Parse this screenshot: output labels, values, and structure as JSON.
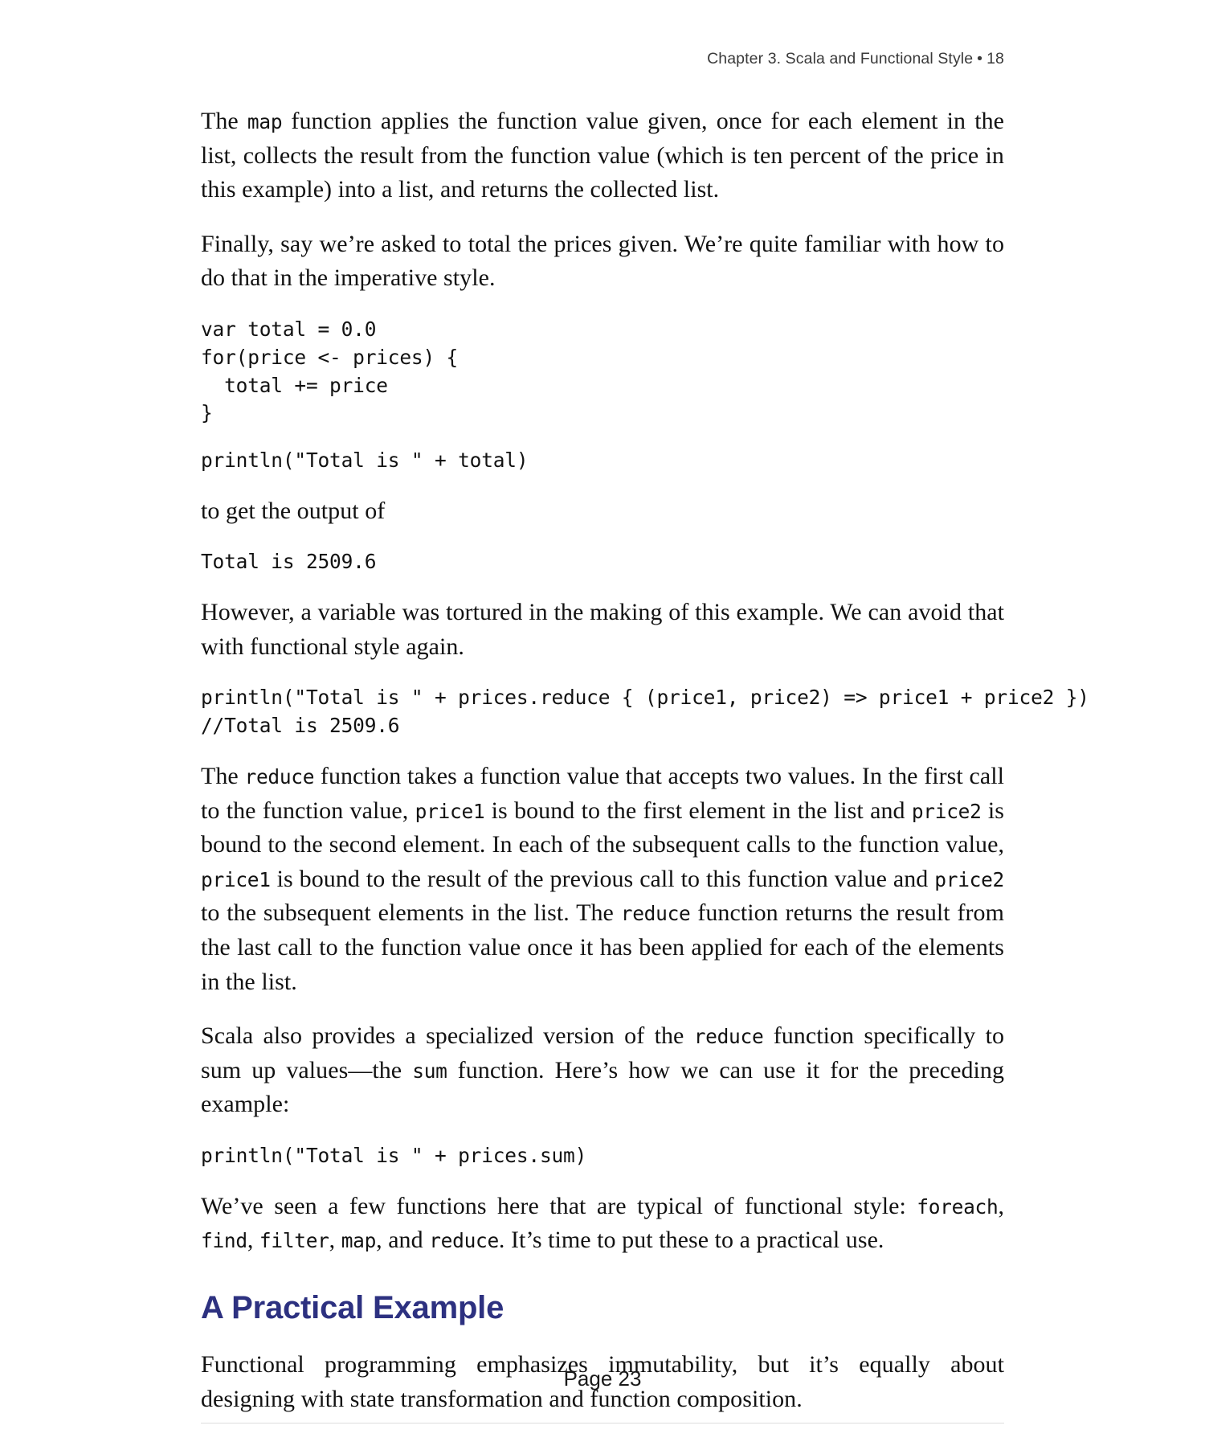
{
  "document": {
    "running_header": {
      "chapter": "Chapter 3. Scala and Functional Style",
      "bullet": "•",
      "page_number": "18"
    },
    "footer": {
      "page_label": "Page 23"
    },
    "accent_color": "#2d3180",
    "blocks": [
      {
        "id": "p-map",
        "type": "paragraph",
        "parts": [
          {
            "kind": "text",
            "value": "The "
          },
          {
            "kind": "code",
            "value": "map"
          },
          {
            "kind": "text",
            "value": " function applies the function value given, once for each element in the list, collects the result from the function value (which is ten percent of the price in this example) into a list, and returns the collected list."
          }
        ]
      },
      {
        "id": "p-finally",
        "type": "paragraph",
        "parts": [
          {
            "kind": "text",
            "value": "Finally, say we’re asked to total the prices given. We’re quite familiar with how to do that in the imperative style."
          }
        ]
      },
      {
        "id": "code-for-loop",
        "type": "code",
        "value": "var total = 0.0\nfor(price <- prices) {\n  total += price\n}"
      },
      {
        "id": "code-println-total",
        "type": "code",
        "value": "println(\"Total is \" + total)"
      },
      {
        "id": "p-output",
        "type": "paragraph",
        "parts": [
          {
            "kind": "text",
            "value": "to get the output of"
          }
        ]
      },
      {
        "id": "code-output-total",
        "type": "code",
        "value": "Total is 2509.6"
      },
      {
        "id": "p-however",
        "type": "paragraph",
        "parts": [
          {
            "kind": "text",
            "value": "However, a variable was tortured in the making of this example. We can avoid that with functional style again."
          }
        ]
      },
      {
        "id": "code-reduce",
        "type": "code",
        "value": "println(\"Total is \" + prices.reduce { (price1, price2) => price1 + price2 })\n//Total is 2509.6"
      },
      {
        "id": "p-reduce-explain",
        "type": "paragraph",
        "parts": [
          {
            "kind": "text",
            "value": "The "
          },
          {
            "kind": "code",
            "value": "reduce"
          },
          {
            "kind": "text",
            "value": " function takes a function value that accepts two values. In the first call to the function value, "
          },
          {
            "kind": "code",
            "value": "price1"
          },
          {
            "kind": "text",
            "value": " is bound to the first element in the list and "
          },
          {
            "kind": "code",
            "value": "price2"
          },
          {
            "kind": "text",
            "value": " is bound to the second element. In each of the subsequent calls to the function value, "
          },
          {
            "kind": "code",
            "value": "price1"
          },
          {
            "kind": "text",
            "value": " is bound to the result of the previous call to this function value and "
          },
          {
            "kind": "code",
            "value": "price2"
          },
          {
            "kind": "text",
            "value": " to the subsequent elements in the list. The "
          },
          {
            "kind": "code",
            "value": "reduce"
          },
          {
            "kind": "text",
            "value": " function returns the result from the last call to the function value once it has been applied for each of the elements in the list."
          }
        ]
      },
      {
        "id": "p-sum-explain",
        "type": "paragraph",
        "parts": [
          {
            "kind": "text",
            "value": "Scala also provides a specialized version of the "
          },
          {
            "kind": "code",
            "value": "reduce"
          },
          {
            "kind": "text",
            "value": " function specifically to sum up values—the "
          },
          {
            "kind": "code",
            "value": "sum"
          },
          {
            "kind": "text",
            "value": " function. Here’s how we can use it for the preceding example:"
          }
        ]
      },
      {
        "id": "code-sum",
        "type": "code",
        "value": "println(\"Total is \" + prices.sum)"
      },
      {
        "id": "p-recap",
        "type": "paragraph",
        "parts": [
          {
            "kind": "text",
            "value": "We’ve seen a few functions here that are typical of functional style: "
          },
          {
            "kind": "code",
            "value": "foreach"
          },
          {
            "kind": "text",
            "value": ", "
          },
          {
            "kind": "code",
            "value": "find"
          },
          {
            "kind": "text",
            "value": ", "
          },
          {
            "kind": "code",
            "value": "filter"
          },
          {
            "kind": "text",
            "value": ", "
          },
          {
            "kind": "code",
            "value": "map"
          },
          {
            "kind": "text",
            "value": ", and "
          },
          {
            "kind": "code",
            "value": "reduce"
          },
          {
            "kind": "text",
            "value": ". It’s time to put these to a practical use."
          }
        ]
      },
      {
        "id": "h-practical-example",
        "type": "heading",
        "value": "A Practical Example"
      },
      {
        "id": "p-fp-intro",
        "type": "paragraph",
        "parts": [
          {
            "kind": "text",
            "value": "Functional programming emphasizes immutability, but it’s equally about designing with state transformation and function composition."
          }
        ]
      }
    ]
  }
}
